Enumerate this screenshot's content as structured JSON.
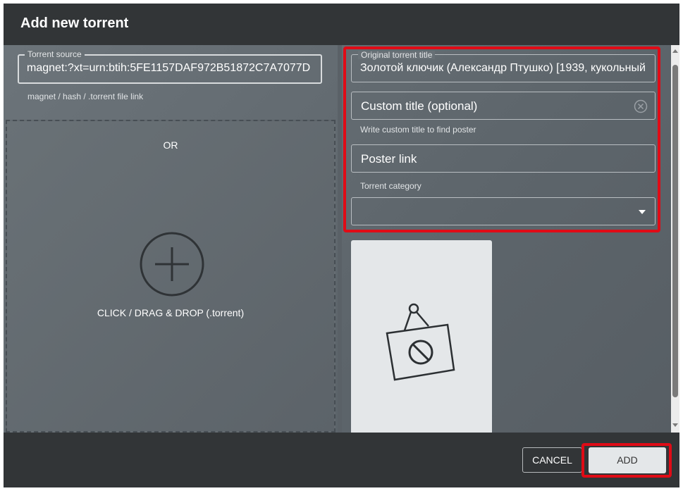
{
  "dialog": {
    "title": "Add new torrent"
  },
  "source": {
    "legend": "Torrent source",
    "value": "magnet:?xt=urn:btih:5FE1157DAF972B51872C7A7077D",
    "helper": "magnet / hash / .torrent file link"
  },
  "dropzone": {
    "or_label": "OR",
    "action_label": "CLICK / DRAG & DROP (.torrent)"
  },
  "details": {
    "original_title_legend": "Original torrent title",
    "original_title_value": "Золотой ключик (Александр Птушко) [1939, кукольный",
    "custom_title_placeholder": "Custom title (optional)",
    "custom_title_helper": "Write custom title to find poster",
    "poster_link_placeholder": "Poster link",
    "category_label": "Torrent category",
    "category_value": ""
  },
  "footer": {
    "cancel_label": "CANCEL",
    "add_label": "ADD"
  },
  "colors": {
    "highlight": "#e00b16",
    "titlebar": "#323537",
    "panel": "#575e64"
  },
  "icons": {
    "add": "plus-circle-icon",
    "clear": "clear-circle-icon",
    "dropdown": "caret-down-icon",
    "poster": "no-poster-icon"
  }
}
